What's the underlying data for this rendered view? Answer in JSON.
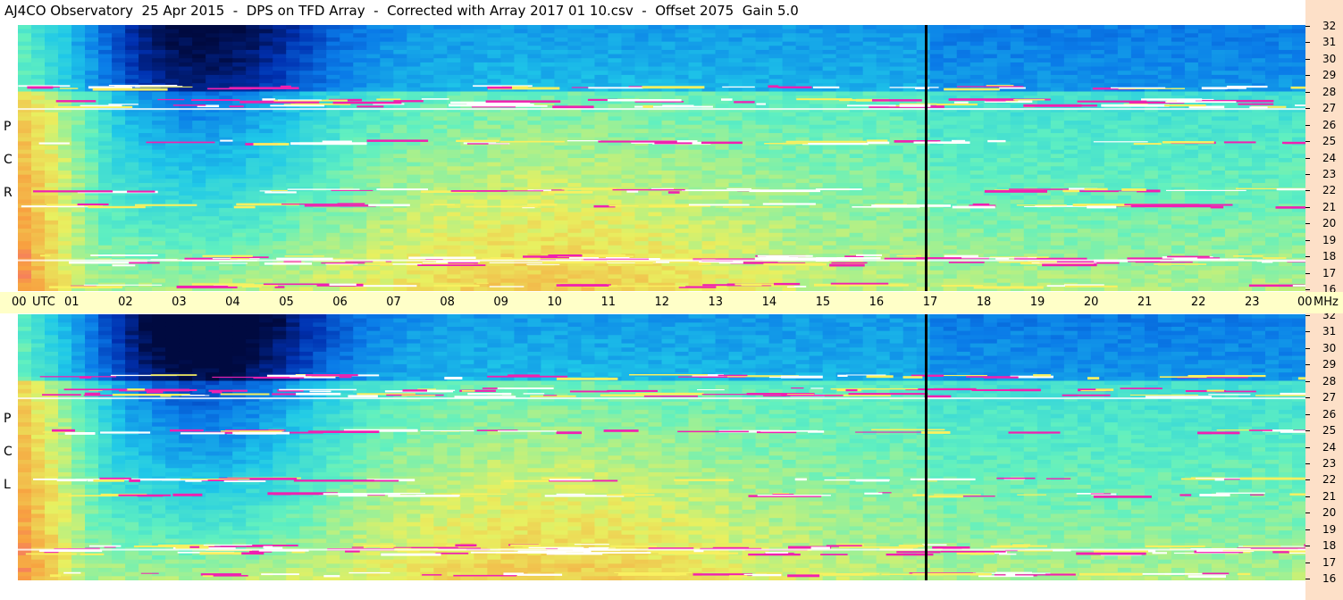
{
  "title": "AJ4CO Observatory  25 Apr 2015  -  DPS on TFD Array  -  Corrected with Array 2017 01 10.csv  -  Offset 2075  Gain 5.0",
  "panels": [
    {
      "label_letters": [
        "P",
        "C",
        "R"
      ]
    },
    {
      "label_letters": [
        "P",
        "C",
        "L"
      ]
    }
  ],
  "time_axis": {
    "labels": [
      "00",
      "UTC",
      "01",
      "02",
      "03",
      "04",
      "05",
      "06",
      "07",
      "08",
      "09",
      "10",
      "11",
      "12",
      "13",
      "14",
      "15",
      "16",
      "17",
      "18",
      "19",
      "20",
      "21",
      "22",
      "23",
      "00",
      "MHz"
    ]
  },
  "chart_data": {
    "type": "heatmap",
    "title": "AJ4CO Observatory  25 Apr 2015  -  DPS on TFD Array  -  Corrected with Array 2017 01 10.csv  -  Offset 2075  Gain 5.0",
    "x_units": "UTC",
    "x_range": [
      0,
      24
    ],
    "x_ticks": [
      "00",
      "01",
      "02",
      "03",
      "04",
      "05",
      "06",
      "07",
      "08",
      "09",
      "10",
      "11",
      "12",
      "13",
      "14",
      "15",
      "16",
      "17",
      "18",
      "19",
      "20",
      "21",
      "22",
      "23",
      "00"
    ],
    "y_units": "MHz",
    "y_range": [
      16,
      32
    ],
    "y_ticks": [
      "32",
      "31",
      "30",
      "29",
      "28",
      "27",
      "26",
      "25",
      "24",
      "23",
      "22",
      "21",
      "20",
      "19",
      "18",
      "17",
      "16"
    ],
    "panels": [
      "RCP",
      "LCP"
    ],
    "marker_time_utc": 16.9,
    "colormap": [
      "#000a40",
      "#0030b0",
      "#0a7be8",
      "#1fc8e8",
      "#60f0c0",
      "#e8f060",
      "#f8a040",
      "#f020b0",
      "#ffffff"
    ]
  }
}
